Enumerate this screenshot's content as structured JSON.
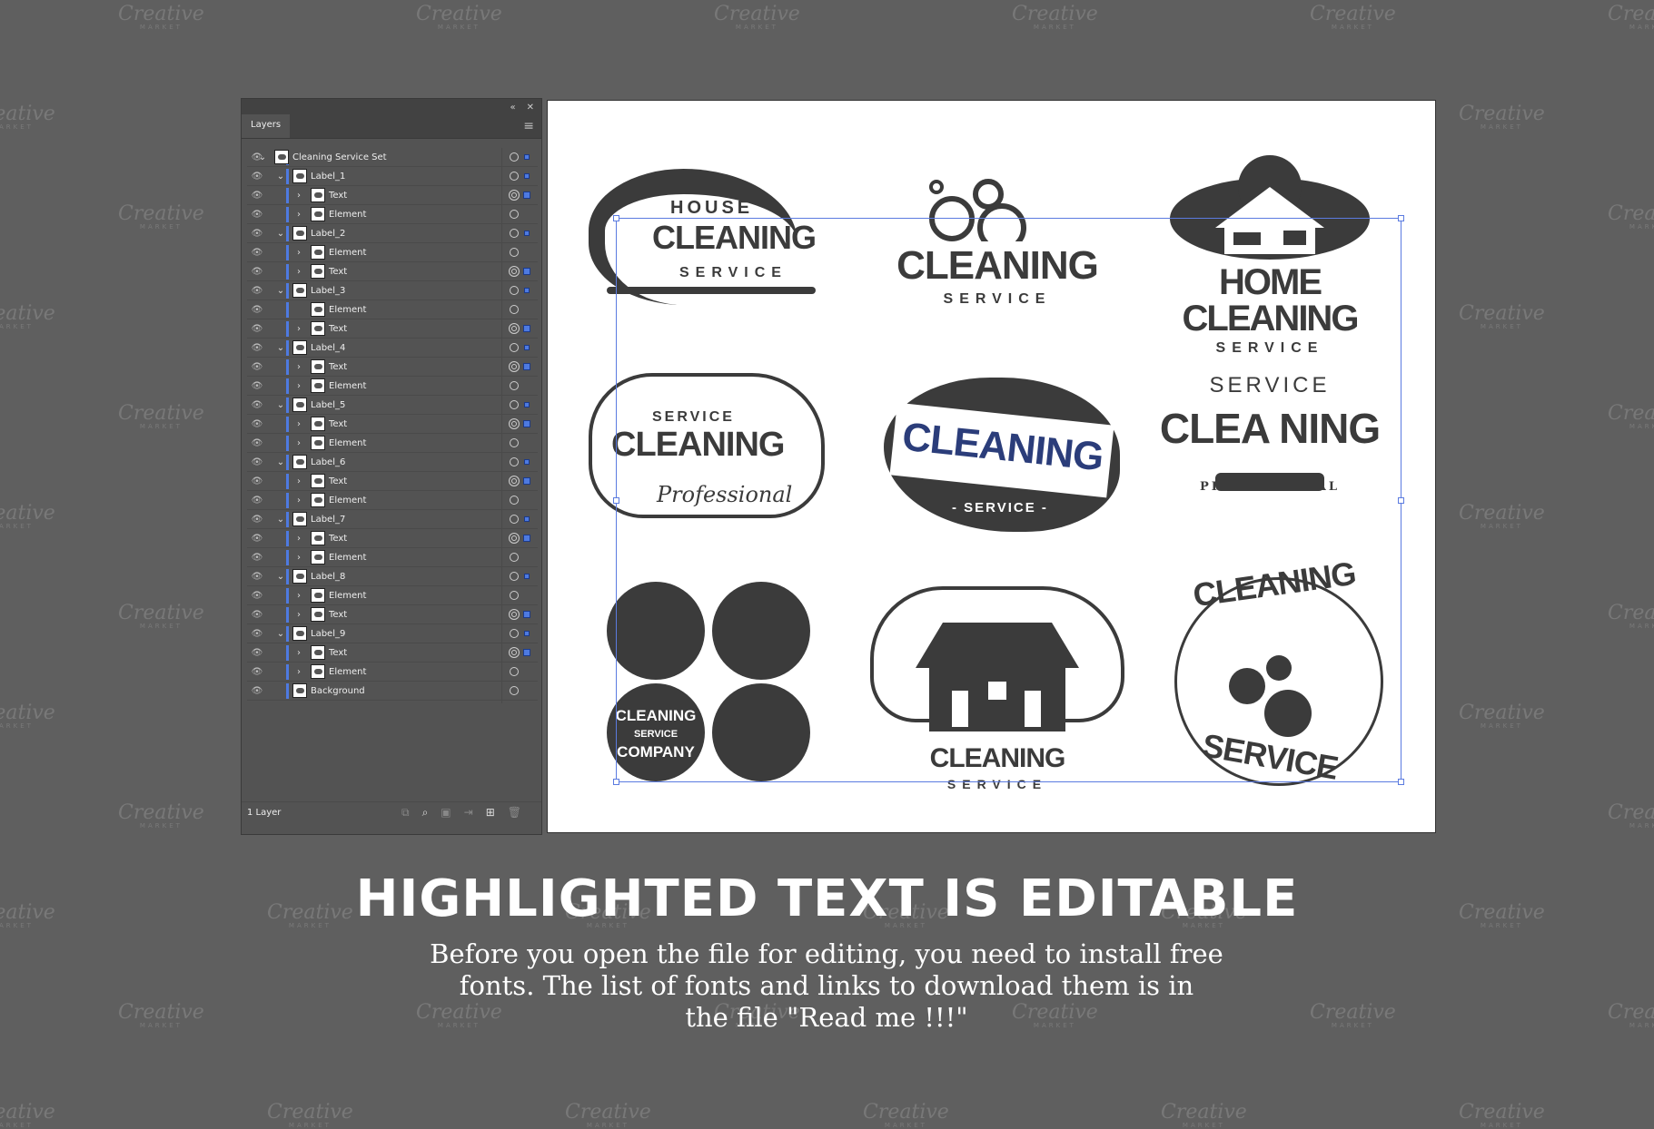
{
  "watermark": {
    "text": "Creative",
    "sub": "MARKET"
  },
  "panel": {
    "title": "Layers",
    "collapse_icon": "double-chevron-left-icon",
    "close_icon": "close-icon",
    "menu_icon": "hamburger-icon",
    "footer": "1 Layer",
    "footer_icons": [
      "export-icon",
      "search-icon",
      "clip-mask-icon",
      "move-to-layer-icon",
      "new-sublayer-icon",
      "trash-icon"
    ],
    "accent": "#4e7ae0",
    "rows": [
      {
        "name": "Cleaning Service Set",
        "level": 0,
        "chevron": "down",
        "target": "single",
        "sel": "small"
      },
      {
        "name": "Label_1",
        "level": 1,
        "chevron": "down",
        "target": "single",
        "sel": "small"
      },
      {
        "name": "Text",
        "level": 2,
        "chevron": "right",
        "target": "double",
        "sel": "big"
      },
      {
        "name": "Element",
        "level": 2,
        "chevron": "right",
        "target": "single",
        "sel": ""
      },
      {
        "name": "Label_2",
        "level": 1,
        "chevron": "down",
        "target": "single",
        "sel": "small"
      },
      {
        "name": "Element",
        "level": 2,
        "chevron": "right",
        "target": "single",
        "sel": ""
      },
      {
        "name": "Text",
        "level": 2,
        "chevron": "right",
        "target": "double",
        "sel": "big"
      },
      {
        "name": "Label_3",
        "level": 1,
        "chevron": "down",
        "target": "single",
        "sel": "small"
      },
      {
        "name": "Element",
        "level": 2,
        "chevron": "",
        "target": "single",
        "sel": ""
      },
      {
        "name": "Text",
        "level": 2,
        "chevron": "right",
        "target": "double",
        "sel": "big"
      },
      {
        "name": "Label_4",
        "level": 1,
        "chevron": "down",
        "target": "single",
        "sel": "small"
      },
      {
        "name": "Text",
        "level": 2,
        "chevron": "right",
        "target": "double",
        "sel": "big"
      },
      {
        "name": "Element",
        "level": 2,
        "chevron": "right",
        "target": "single",
        "sel": ""
      },
      {
        "name": "Label_5",
        "level": 1,
        "chevron": "down",
        "target": "single",
        "sel": "small"
      },
      {
        "name": "Text",
        "level": 2,
        "chevron": "right",
        "target": "double",
        "sel": "big"
      },
      {
        "name": "Element",
        "level": 2,
        "chevron": "right",
        "target": "single",
        "sel": ""
      },
      {
        "name": "Label_6",
        "level": 1,
        "chevron": "down",
        "target": "single",
        "sel": "small"
      },
      {
        "name": "Text",
        "level": 2,
        "chevron": "right",
        "target": "double",
        "sel": "big"
      },
      {
        "name": "Element",
        "level": 2,
        "chevron": "right",
        "target": "single",
        "sel": ""
      },
      {
        "name": "Label_7",
        "level": 1,
        "chevron": "down",
        "target": "single",
        "sel": "small"
      },
      {
        "name": "Text",
        "level": 2,
        "chevron": "right",
        "target": "double",
        "sel": "big"
      },
      {
        "name": "Element",
        "level": 2,
        "chevron": "right",
        "target": "single",
        "sel": ""
      },
      {
        "name": "Label_8",
        "level": 1,
        "chevron": "down",
        "target": "single",
        "sel": "small"
      },
      {
        "name": "Element",
        "level": 2,
        "chevron": "right",
        "target": "single",
        "sel": ""
      },
      {
        "name": "Text",
        "level": 2,
        "chevron": "right",
        "target": "double",
        "sel": "big"
      },
      {
        "name": "Label_9",
        "level": 1,
        "chevron": "down",
        "target": "single",
        "sel": "small"
      },
      {
        "name": "Text",
        "level": 2,
        "chevron": "right",
        "target": "double",
        "sel": "big"
      },
      {
        "name": "Element",
        "level": 2,
        "chevron": "right",
        "target": "single",
        "sel": ""
      },
      {
        "name": "Background",
        "level": 1,
        "chevron": "",
        "target": "single",
        "sel": ""
      }
    ]
  },
  "logos": [
    {
      "top": "HOUSE",
      "main": "CLEANING",
      "sub": "SERVICE"
    },
    {
      "top": "",
      "main": "CLEANING",
      "sub": "SERVICE"
    },
    {
      "top": "",
      "main": "HOME CLEANING",
      "sub": "SERVICE"
    },
    {
      "top": "SERVICE",
      "main": "CLEANING",
      "sub": "Professional"
    },
    {
      "top": "",
      "main": "CLEANING",
      "sub": "- SERVICE -"
    },
    {
      "top": "SERVICE",
      "main": "CLEA NING",
      "sub": "PROFESSIONAL"
    },
    {
      "top": "CLEANING",
      "main": "SERVICE",
      "sub": "COMPANY"
    },
    {
      "top": "",
      "main": "CLEANING",
      "sub": "SERVICE"
    },
    {
      "top": "CLEANING",
      "main": "",
      "sub": "SERVICE"
    }
  ],
  "headline": "HIGHLIGHTED TEXT IS EDITABLE",
  "body": [
    "Before you open the file for editing, you need to install free",
    "fonts. The list of fonts and links to download them is in",
    "the file \"Read me !!!\""
  ]
}
